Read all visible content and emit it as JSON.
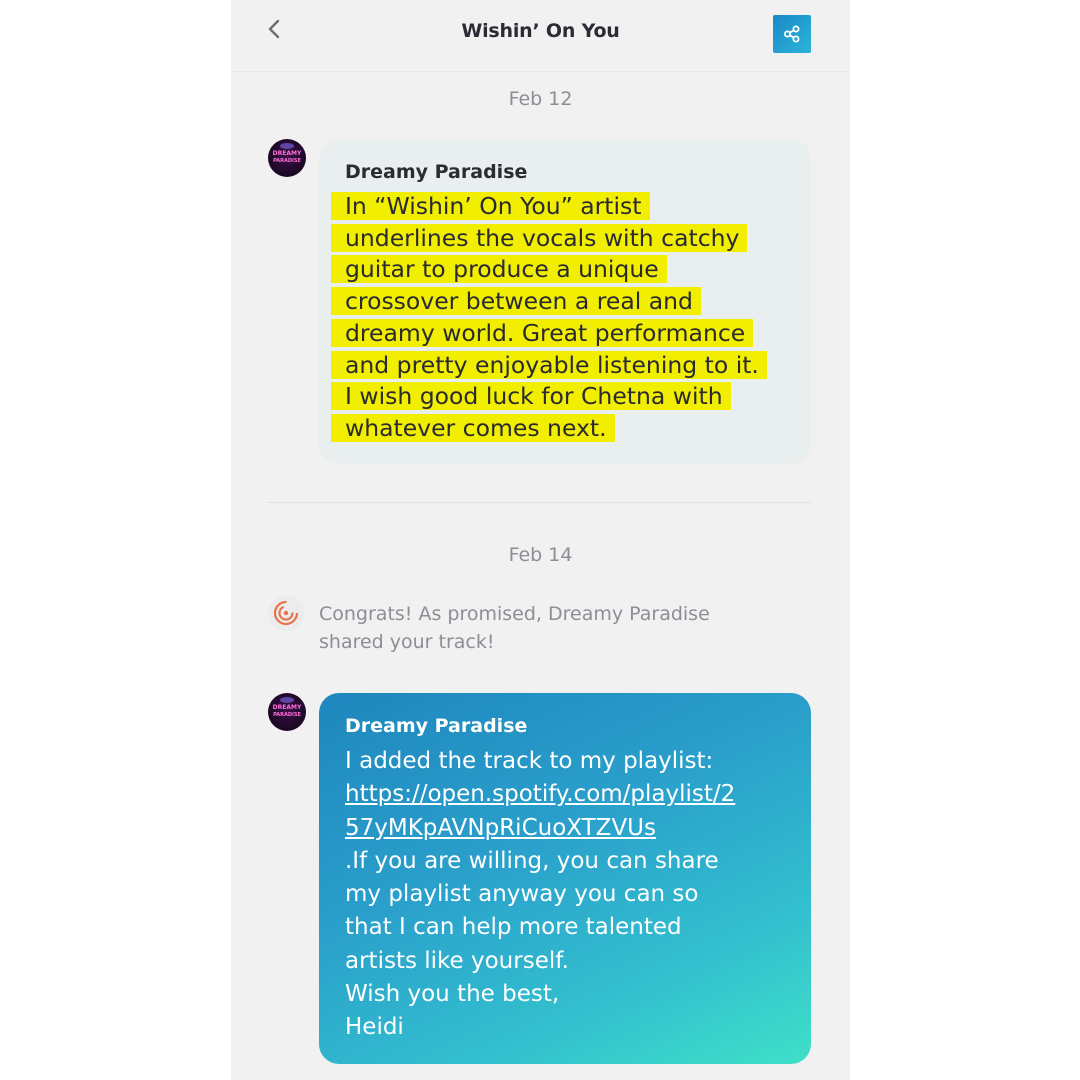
{
  "header": {
    "title": "Wishin’ On You"
  },
  "conversation": {
    "date_1": "Feb 12",
    "message_1": {
      "sender": "Dreamy Paradise",
      "avatar_text_top": "DREAMY",
      "avatar_text_bottom": "PARADISE",
      "lines": [
        "In “Wishin’ On You” artist",
        "underlines the vocals with catchy",
        "guitar to produce a unique",
        "crossover between a real and",
        "dreamy world. Great performance",
        "and pretty enjoyable listening to it.",
        "I wish good luck for Chetna with",
        "whatever comes next."
      ]
    },
    "date_2": "Feb 14",
    "system_message": {
      "line_1": "Congrats! As promised, Dreamy Paradise",
      "line_2": "shared your track!"
    },
    "message_2": {
      "sender": "Dreamy Paradise",
      "avatar_text_top": "DREAMY",
      "avatar_text_bottom": "PARADISE",
      "intro": "I added the track to my playlist:",
      "link_line_1": "https://open.spotify.com/playlist/2",
      "link_line_2": "57yMKpAVNpRiCuoXTZVUs",
      "lines_after": [
        ".If you are willing, you can share",
        "my playlist anyway you can so",
        "that I can help more talented",
        "artists like yourself.",
        "Wish you the best,",
        "Heidi"
      ]
    }
  },
  "colors": {
    "highlight": "#f1ee00",
    "bubble_gradient_start": "#1e86bd",
    "bubble_gradient_end": "#3fe0c8",
    "system_icon": "#e8734a"
  },
  "icons": {
    "back": "chevron-left-icon",
    "share": "share-icon",
    "system": "target-swirl-icon"
  }
}
